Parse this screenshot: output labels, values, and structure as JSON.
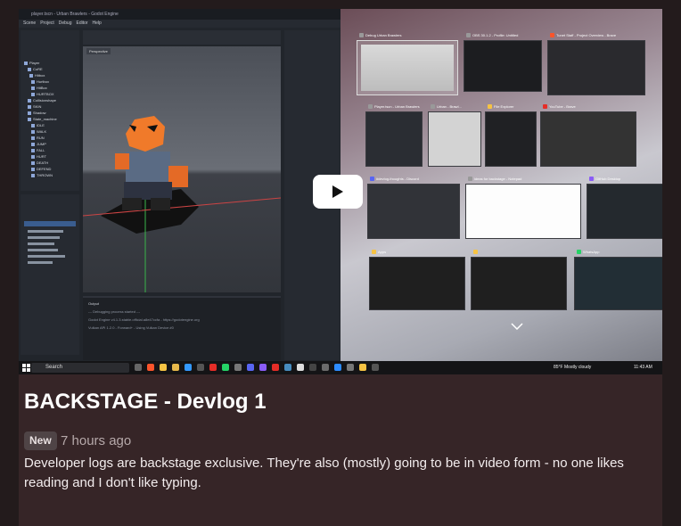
{
  "post": {
    "title": "BACKSTAGE - Devlog 1",
    "badge": "New",
    "time": "7 hours ago",
    "description": "Developer logs are backstage exclusive. They're also (mostly) going to be in video form - no one likes reading and I don't like typing."
  },
  "video": {
    "play_icon": "play-icon",
    "godot_title": "player.tscn - Urban Brawlers - Godot Engine",
    "godot_menu": [
      "Scene",
      "Project",
      "Debug",
      "Editor",
      "Help"
    ],
    "scene_tree": [
      "Player",
      "CoRE",
      "Hitbox",
      "Hurtbox",
      "HitBox",
      "HURTBOX",
      "Collisionshape",
      "SKIN",
      "Shadow",
      "State_machine",
      "IDLE",
      "WALK",
      "RUN",
      "JUMP",
      "FALL",
      "HURT",
      "DEATH",
      "DEFEND",
      "THROWN"
    ],
    "viewport_tab": "Perspective",
    "output_label": "Output",
    "output_lines": [
      "--- Debugging process started ---",
      "Godot Engine v4.1.3.stable.official.a8e47ccfa - https://godotengine.org",
      "Vulkan API 1.2.0 - Forward+ - Using Vulkan Device #0"
    ],
    "windows": [
      {
        "title": "Debug Urban Brawlers"
      },
      {
        "title": "OBS 30.1.2 - Profile: Untitled"
      },
      {
        "title": "Tunet Staff - Project Overview - Brave"
      },
      {
        "title": "Player.tscn - Urban Brawlers"
      },
      {
        "title": "Urban - Brawl..."
      },
      {
        "title": "File Explorer"
      },
      {
        "title": "YouTube - Brave"
      },
      {
        "title": "#devlog-thoughts - Discord"
      },
      {
        "title": "ideas for backstage - Notepad"
      },
      {
        "title": "GitHub Desktop"
      },
      {
        "title": "Apps"
      },
      {
        "title": ""
      },
      {
        "title": "WhatsApp"
      }
    ],
    "taskbar": {
      "search": "Search",
      "weather": "85°F  Mostly cloudy",
      "time": "11:43 AM"
    }
  }
}
